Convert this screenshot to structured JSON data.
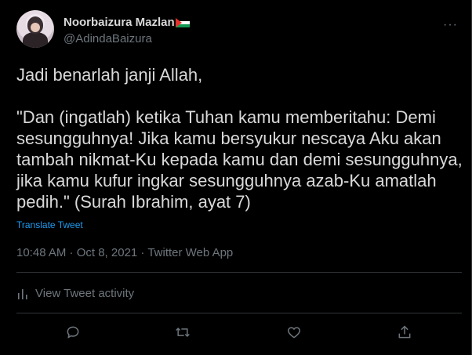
{
  "user": {
    "display_name": "Noorbaizura Mazlan",
    "handle": "@AdindaBaizura",
    "avatar_icon": "profile-photo",
    "flag_icon": "palestine-flag-emoji"
  },
  "menu": {
    "more_icon": "ellipsis-icon",
    "more_label": "···"
  },
  "tweet": {
    "text": "Jadi benarlah janji Allah,\n\n\"Dan (ingatlah) ketika Tuhan kamu memberitahu: Demi sesungguhnya! Jika kamu bersyukur nescaya Aku akan tambah nikmat-Ku kepada kamu dan demi sesungguhnya, jika kamu kufur ingkar sesungguhnya azab-Ku amatlah pedih.\" (Surah Ibrahim, ayat 7)",
    "translate_label": "Translate Tweet",
    "timestamp": "10:48 AM · Oct 8, 2021 · Twitter Web App"
  },
  "activity": {
    "label": "View Tweet activity",
    "icon": "bar-chart-icon"
  },
  "actions": {
    "reply_icon": "reply-icon",
    "retweet_icon": "retweet-icon",
    "like_icon": "heart-icon",
    "share_icon": "share-icon"
  },
  "colors": {
    "background": "#000000",
    "text": "#d9d9d9",
    "muted": "#6e767d",
    "link": "#1d9bf0",
    "divider": "#2f3336"
  }
}
